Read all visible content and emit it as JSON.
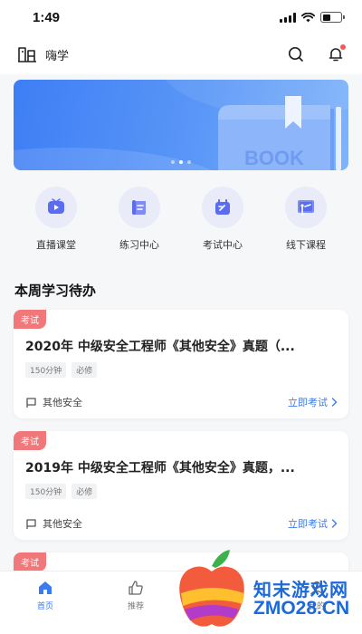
{
  "status_bar": {
    "time": "1:49"
  },
  "header": {
    "app_name": "嗨学",
    "icons": [
      "logo-icon",
      "search-icon",
      "bell-icon"
    ]
  },
  "banner": {
    "book_text": "BOOK",
    "slide_count": 3,
    "active_slide": 2
  },
  "quick_nav": [
    {
      "label": "直播课堂",
      "icon": "live-video-icon"
    },
    {
      "label": "练习中心",
      "icon": "scroll-icon"
    },
    {
      "label": "考试中心",
      "icon": "calendar-icon"
    },
    {
      "label": "线下课程",
      "icon": "classroom-board-icon"
    }
  ],
  "section": {
    "title": "本周学习待办"
  },
  "todos": [
    {
      "tag": "考试",
      "title": "2020年 中级安全工程师《其他安全》真题（...",
      "duration": "150分钟",
      "requirement": "必修",
      "category": "其他安全",
      "action": "立即考试"
    },
    {
      "tag": "考试",
      "title": "2019年 中级安全工程师《其他安全》真题，...",
      "duration": "150分钟",
      "requirement": "必修",
      "category": "其他安全",
      "action": "立即考试"
    },
    {
      "tag": "考试"
    }
  ],
  "tabs": [
    {
      "label": "首页",
      "active": true
    },
    {
      "label": "推荐",
      "active": false
    },
    {
      "label": "",
      "active": false
    },
    {
      "label": "我的",
      "active": false
    }
  ],
  "watermark": {
    "line1": "知末游戏网",
    "line2": "ZMO28.CN"
  },
  "colors": {
    "accent": "#3a7bf0",
    "tag": "#f0787a",
    "banner": "#4a88f6",
    "watermark": "#1d69d9"
  }
}
